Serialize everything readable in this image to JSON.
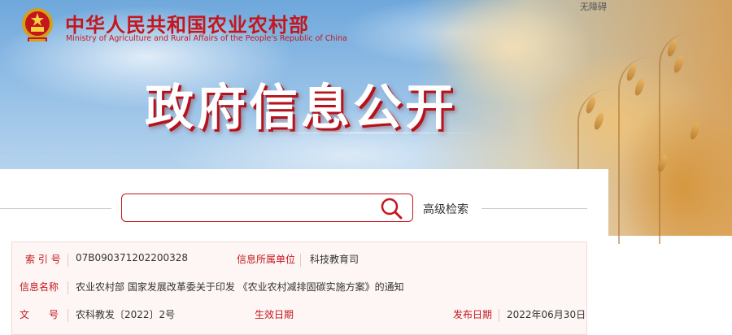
{
  "header": {
    "ministry_cn": "中华人民共和国农业农村部",
    "ministry_en": "Ministry of Agriculture and Rural Affairs of the People's Republic of China",
    "accessibility_link": "无障碍",
    "title": "政府信息公开"
  },
  "search": {
    "value": "",
    "placeholder": "",
    "advanced_label": "高级检索"
  },
  "info": {
    "index_label": "索 引 号",
    "index_value": "07B090371202200328",
    "unit_label": "信息所属单位",
    "unit_value": "科技教育司",
    "name_label": "信息名称",
    "name_value": "农业农村部 国家发展改革委关于印发 《农业农村减排固碳实施方案》的通知",
    "doc_label": "文　　号",
    "doc_value": "农科教发〔2022〕2号",
    "effective_label": "生效日期",
    "effective_value": "",
    "publish_label": "发布日期",
    "publish_value": "2022年06月30日"
  },
  "colors": {
    "brand_red": "#c4161c",
    "table_bg": "#fdf6f4"
  },
  "icons": {
    "emblem": "national-emblem-icon",
    "search": "search-icon"
  }
}
